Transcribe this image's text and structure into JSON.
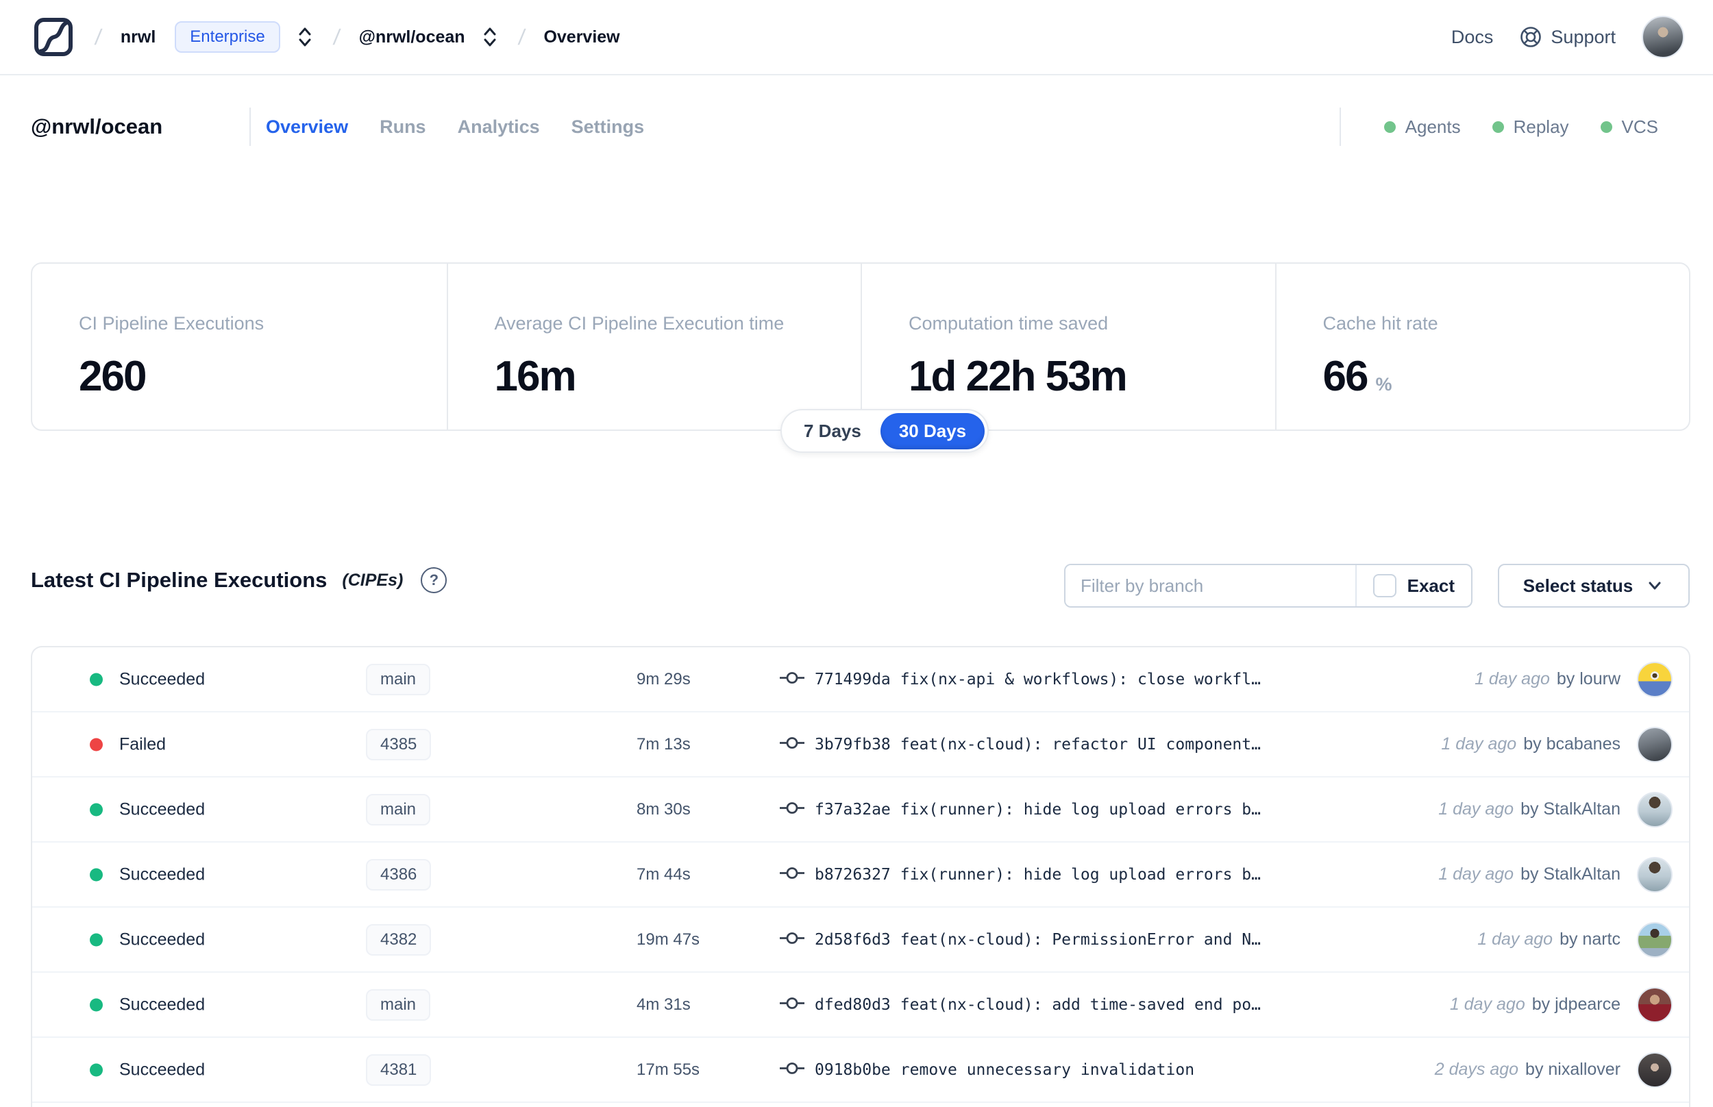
{
  "colors": {
    "accent_blue": "#2563eb",
    "success_green": "#18b981",
    "failed_red": "#ee4444",
    "indicator_green": "#72c48b",
    "muted_label": "#9aa7b8"
  },
  "topbar": {
    "breadcrumb": {
      "workspace": "nrwl",
      "plan_badge": "Enterprise",
      "project": "@nrwl/ocean",
      "page": "Overview"
    },
    "docs_label": "Docs",
    "support_label": "Support"
  },
  "header": {
    "title": "@nrwl/ocean",
    "tabs": [
      {
        "label": "Overview",
        "active": true
      },
      {
        "label": "Runs",
        "active": false
      },
      {
        "label": "Analytics",
        "active": false
      },
      {
        "label": "Settings",
        "active": false
      }
    ],
    "indicators": [
      {
        "label": "Agents",
        "status": "on"
      },
      {
        "label": "Replay",
        "status": "on"
      },
      {
        "label": "VCS",
        "status": "on"
      }
    ]
  },
  "stats": {
    "cards": [
      {
        "label": "CI Pipeline Executions",
        "value": "260",
        "suffix": ""
      },
      {
        "label": "Average CI Pipeline Execution time",
        "value": "16m",
        "suffix": ""
      },
      {
        "label": "Computation time saved",
        "value": "1d 22h 53m",
        "suffix": ""
      },
      {
        "label": "Cache hit rate",
        "value": "66",
        "suffix": "%"
      }
    ],
    "range_toggle": {
      "options": [
        "7 Days",
        "30 Days"
      ],
      "selected": "30 Days"
    }
  },
  "cipes": {
    "title": "Latest CI Pipeline Executions",
    "title_suffix": "(CIPEs)",
    "filter_placeholder": "Filter by branch",
    "filter_value": "",
    "exact_label": "Exact",
    "exact_checked": false,
    "status_dropdown_label": "Select status",
    "rows": [
      {
        "status": "Succeeded",
        "status_color": "#18b981",
        "branch": "main",
        "duration": "9m 29s",
        "commit_hash": "771499da",
        "commit_message": "fix(nx-api & workflows): close workfl…",
        "time_ago": "1 day ago",
        "author": "by lourw",
        "avatar": "lourw"
      },
      {
        "status": "Failed",
        "status_color": "#ee4444",
        "branch": "4385",
        "duration": "7m 13s",
        "commit_hash": "3b79fb38",
        "commit_message": "feat(nx-cloud): refactor UI component…",
        "time_ago": "1 day ago",
        "author": "by bcabanes",
        "avatar": "bcabanes"
      },
      {
        "status": "Succeeded",
        "status_color": "#18b981",
        "branch": "main",
        "duration": "8m 30s",
        "commit_hash": "f37a32ae",
        "commit_message": "fix(runner): hide log upload errors b…",
        "time_ago": "1 day ago",
        "author": "by StalkAltan",
        "avatar": "StalkAltan"
      },
      {
        "status": "Succeeded",
        "status_color": "#18b981",
        "branch": "4386",
        "duration": "7m 44s",
        "commit_hash": "b8726327",
        "commit_message": "fix(runner): hide log upload errors b…",
        "time_ago": "1 day ago",
        "author": "by StalkAltan",
        "avatar": "StalkAltan"
      },
      {
        "status": "Succeeded",
        "status_color": "#18b981",
        "branch": "4382",
        "duration": "19m 47s",
        "commit_hash": "2d58f6d3",
        "commit_message": "feat(nx-cloud): PermissionError and N…",
        "time_ago": "1 day ago",
        "author": "by nartc",
        "avatar": "nartc"
      },
      {
        "status": "Succeeded",
        "status_color": "#18b981",
        "branch": "main",
        "duration": "4m 31s",
        "commit_hash": "dfed80d3",
        "commit_message": "feat(nx-cloud): add time-saved end po…",
        "time_ago": "1 day ago",
        "author": "by jdpearce",
        "avatar": "jdpearce"
      },
      {
        "status": "Succeeded",
        "status_color": "#18b981",
        "branch": "4381",
        "duration": "17m 55s",
        "commit_hash": "0918b0be",
        "commit_message": "remove unnecessary invalidation",
        "time_ago": "2 days ago",
        "author": "by nixallover",
        "avatar": "nixallover"
      }
    ]
  }
}
